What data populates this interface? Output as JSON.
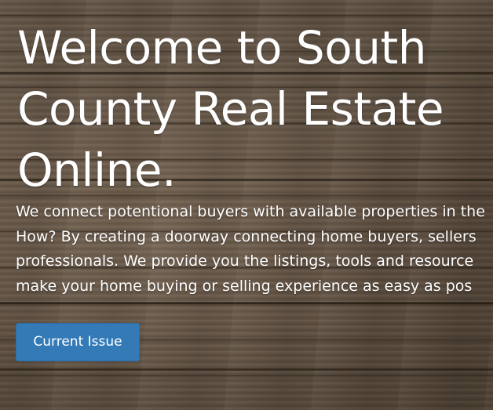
{
  "hero": {
    "title_lines": [
      "Welcome to South",
      "County Real Estate",
      "Online."
    ],
    "intro_lines": [
      "We connect potentional buyers with available properties in the",
      "How? By creating a doorway connecting home buyers, sellers",
      "professionals. We provide you the listings, tools and resource",
      "make your home buying or selling experience as easy as pos"
    ],
    "cta_label": "Current Issue"
  },
  "colors": {
    "button_primary": "#337ab7",
    "text": "#ffffff",
    "background": "#6d5f50"
  }
}
